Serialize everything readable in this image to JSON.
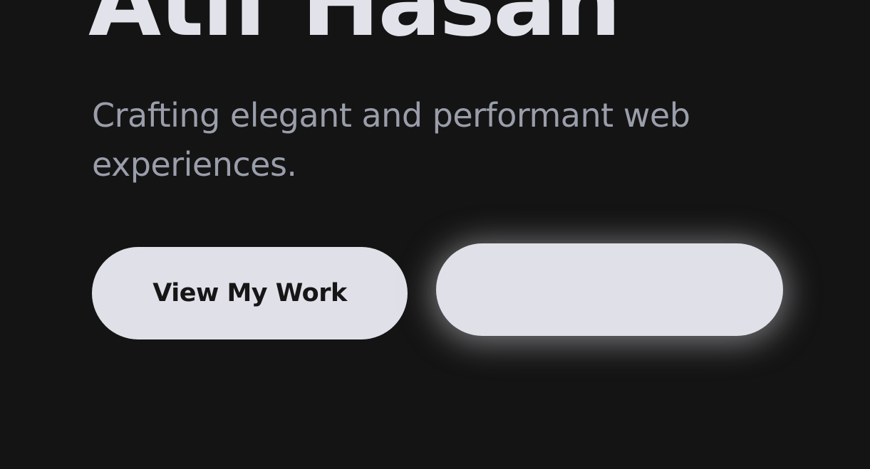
{
  "hero": {
    "name": "Atif Hasan",
    "tagline": "Crafting elegant and performant web experiences.",
    "buttons": {
      "primary_label": "View My Work",
      "secondary_label": ""
    }
  },
  "colors": {
    "background": "#141414",
    "name_text": "#e2e3ea",
    "tagline_text": "#9a9eaa",
    "button_background": "#dfe0e8",
    "button_text": "#161616"
  }
}
